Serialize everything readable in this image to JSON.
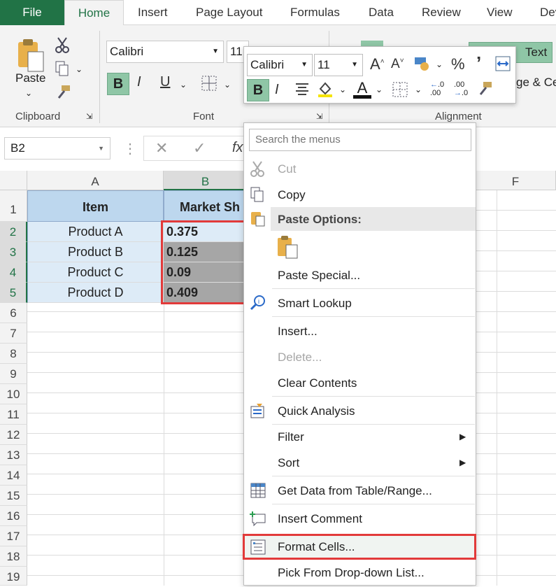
{
  "tabs": [
    "File",
    "Home",
    "Insert",
    "Page Layout",
    "Formulas",
    "Data",
    "Review",
    "View",
    "Dev"
  ],
  "ribbon": {
    "clipboard_label": "Clipboard",
    "paste_label": "Paste",
    "font_label": "Font",
    "alignment_label": "Alignment",
    "font_name": "Calibri",
    "font_size": "11",
    "bold": "B",
    "italic": "I",
    "underline": "U",
    "wrap_text": "Text",
    "merge_center": "ge & Ce"
  },
  "formula_bar": {
    "name_box": "B2",
    "fx": "fx"
  },
  "columns": [
    "A",
    "B",
    "F"
  ],
  "rows": [
    "1",
    "2",
    "3",
    "4",
    "5",
    "6",
    "7",
    "8",
    "9",
    "10",
    "11",
    "12",
    "13",
    "14",
    "15",
    "16",
    "17",
    "18",
    "19"
  ],
  "table": {
    "header": [
      "Item",
      "Market Sh"
    ],
    "data": [
      [
        "Product A",
        "0.375"
      ],
      [
        "Product B",
        "0.125"
      ],
      [
        "Product C",
        "0.09"
      ],
      [
        "Product D",
        "0.409"
      ]
    ]
  },
  "mini_toolbar": {
    "font_name": "Calibri",
    "font_size": "11",
    "percent": "%",
    "comma": "’",
    "bold": "B",
    "italic": "I"
  },
  "context_menu": {
    "search_placeholder": "Search the menus",
    "cut": "Cut",
    "copy": "Copy",
    "paste_options": "Paste Options:",
    "paste_special": "Paste Special...",
    "smart_lookup": "Smart Lookup",
    "insert": "Insert...",
    "delete": "Delete...",
    "clear_contents": "Clear Contents",
    "quick_analysis": "Quick Analysis",
    "filter": "Filter",
    "sort": "Sort",
    "get_data": "Get Data from Table/Range...",
    "insert_comment": "Insert Comment",
    "format_cells": "Format Cells...",
    "pick_list": "Pick From Drop-down List..."
  },
  "colors": {
    "accent": "#217346",
    "highlight": "#e23a3a",
    "header_fill": "#bdd7ee",
    "row_fill": "#ddebf7",
    "selected_fill": "#a6a6a6"
  }
}
